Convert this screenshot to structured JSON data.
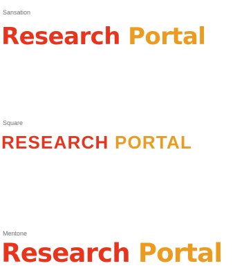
{
  "colors": {
    "primary": "#e8341c",
    "secondary": "#eb9b1f",
    "caption": "#707070"
  },
  "samples": [
    {
      "caption": "Sansation",
      "word1": "Research",
      "word2": "Portal"
    },
    {
      "caption": "Square",
      "word1": "RESEARCH",
      "word2": "PORTAL"
    },
    {
      "caption": "Mentone",
      "word1": "Research",
      "word2": "Portal"
    }
  ]
}
